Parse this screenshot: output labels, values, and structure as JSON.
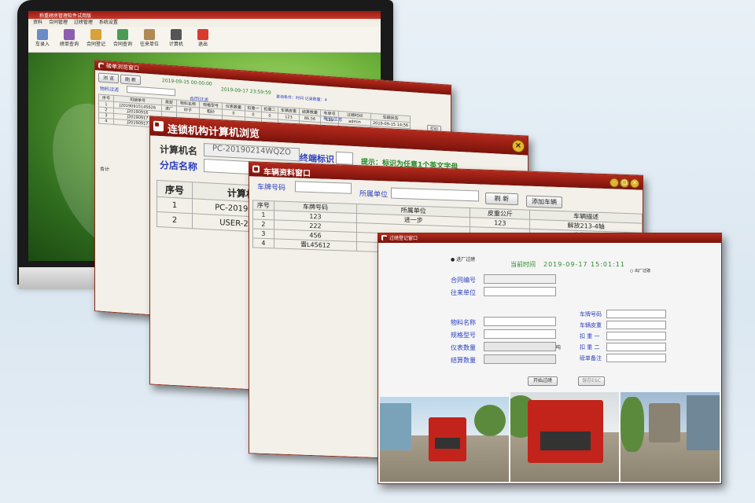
{
  "monitor": {
    "app_title": "称重磅房管理软件试用版",
    "menu": [
      "资料",
      "合同管理",
      "过磅管理",
      "系统设置"
    ],
    "toolbar": [
      {
        "label": "车录入",
        "icon": "truck-entry-icon",
        "color": "#6b8cc9"
      },
      {
        "label": "磅单查询",
        "icon": "weigh-query-icon",
        "color": "#8d5fb0"
      },
      {
        "label": "合同登记",
        "icon": "contract-icon",
        "color": "#d9a23a"
      },
      {
        "label": "合同查询",
        "icon": "contract-query-icon",
        "color": "#4a9b56"
      },
      {
        "label": "往来单位",
        "icon": "book-icon",
        "color": "#b08a56"
      },
      {
        "label": "计算机",
        "icon": "printer-icon",
        "color": "#555555"
      },
      {
        "label": "退出",
        "icon": "exit-icon",
        "color": "#d93a2e"
      }
    ]
  },
  "win1": {
    "title": "磅单浏览窗口",
    "buttons": [
      "浏 览",
      "刷 新"
    ],
    "date_from": "2019-09-15 00:00:00",
    "date_to": "2019-09-17 23:59:59",
    "label_material": "物料过滤",
    "label_contract": "合同过滤",
    "label_plate": "车号过滤",
    "label_unit": "单位过滤",
    "query_info": "查询条件：时间  记录数量：4",
    "print_label": "打印",
    "columns": [
      "序号",
      "司磅单号",
      "类型",
      "物料名称",
      "规格型号",
      "仪表数量",
      "扣重一",
      "扣重二",
      "车辆皮重",
      "结算数量",
      "车单号",
      "过磅时间",
      "车辆状态"
    ],
    "rows": [
      [
        "1",
        "J20190915145626",
        "进厂",
        "砂子",
        "粗砂",
        "0",
        "0",
        "0",
        "123",
        "86.56",
        "123",
        "admin",
        "2019-09-15 14:56",
        "出厂"
      ],
      [
        "2",
        "J20190916",
        "",
        "",
        "",
        "",
        "",
        "",
        "",
        "",
        "",
        "",
        "",
        ""
      ],
      [
        "3",
        "J20190917",
        "",
        "",
        "",
        "",
        "",
        "",
        "",
        "",
        "",
        "",
        "",
        ""
      ],
      [
        "4",
        "J20190917",
        "",
        "",
        "",
        "",
        "",
        "",
        "",
        "",
        "",
        "",
        "",
        ""
      ]
    ],
    "total_label": "合计"
  },
  "win2": {
    "title": "连锁机构计算机浏览",
    "label_pc": "计算机名",
    "value_pc": "PC-20190214WQZO",
    "label_terminal": "终端标识",
    "label_branch": "分店名称",
    "tip": "提示：标识为任意1个英文字母",
    "columns": [
      "序号",
      "计算机"
    ],
    "rows": [
      [
        "1",
        "PC-20190214"
      ],
      [
        "2",
        "USER-2017"
      ]
    ]
  },
  "win3": {
    "title": "车辆资料窗口",
    "label_plate": "车牌号码",
    "label_unit": "所属单位",
    "refresh": "刷 新",
    "add": "添加车辆",
    "columns": [
      "序号",
      "车牌号码",
      "所属单位",
      "皮重公斤",
      "车辆描述"
    ],
    "rows": [
      [
        "1",
        "123",
        "进一步",
        "123",
        "解放213-4轴"
      ],
      [
        "2",
        "222",
        "",
        "",
        "自己油的"
      ],
      [
        "3",
        "456",
        "",
        "",
        ""
      ],
      [
        "4",
        "晋L45612",
        "",
        "",
        ""
      ]
    ]
  },
  "win4": {
    "title": "过磅登记窗口",
    "radio_in": "进厂过磅",
    "radio_out": "出厂过磅",
    "time_label": "当前时间",
    "time_value": "2019-09-17 15:01:11",
    "left_fields": [
      "合同编号",
      "往来单位",
      "物料名称",
      "规格型号",
      "仪表数量",
      "结算数量"
    ],
    "right_fields": [
      "车牌号码",
      "车辆皮重",
      "扣 重 一",
      "扣 重 二",
      "磅单备注"
    ],
    "unit": "吨",
    "start_button": "开始过磅",
    "save_button": "保存ESC"
  }
}
